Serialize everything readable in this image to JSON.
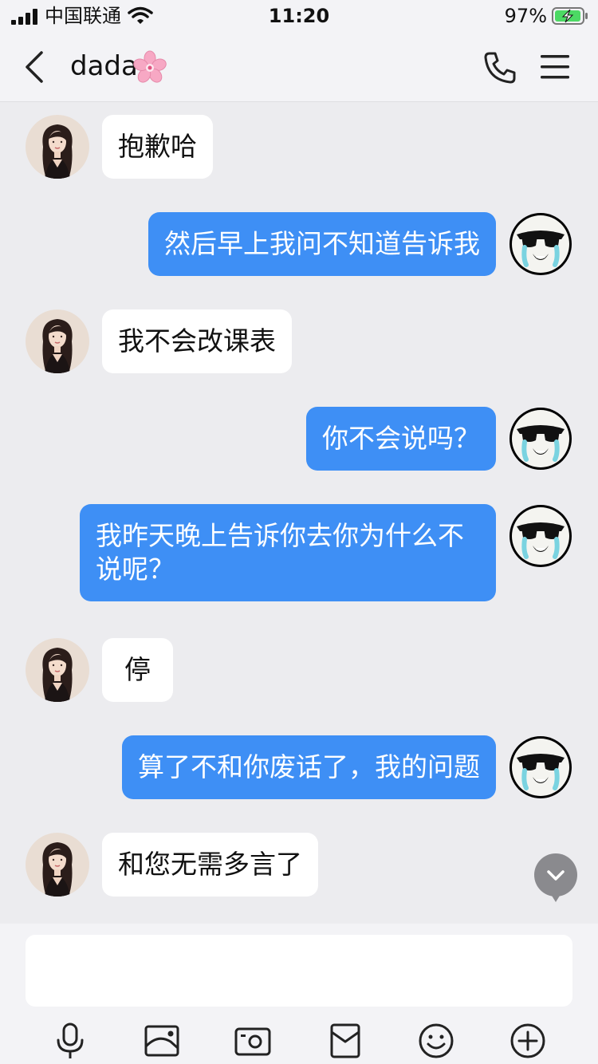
{
  "status_bar": {
    "carrier": "中国联通",
    "time": "11:20",
    "battery_percent": "97%",
    "battery_level": 0.97,
    "icons": [
      "signal-icon",
      "wifi-icon",
      "battery-charging-icon"
    ]
  },
  "nav": {
    "title": "dada",
    "icons": [
      "back-arrow-icon",
      "cherry-blossom-emoji",
      "phone-call-icon",
      "menu-icon"
    ]
  },
  "messages": [
    {
      "side": "left",
      "sender": "dada",
      "text": "抱歉哈"
    },
    {
      "side": "right",
      "sender": "me",
      "text": "然后早上我问不知道告诉我"
    },
    {
      "side": "left",
      "sender": "dada",
      "text": "我不会改课表"
    },
    {
      "side": "right",
      "sender": "me",
      "text": "你不会说吗？"
    },
    {
      "side": "right",
      "sender": "me",
      "text": "我昨天晚上告诉你去你为什么不说呢？"
    },
    {
      "side": "left",
      "sender": "dada",
      "text": "停"
    },
    {
      "side": "right",
      "sender": "me",
      "text": "算了不和你废话了，我的问题"
    },
    {
      "side": "left",
      "sender": "dada",
      "text": "和您无需多言了"
    }
  ],
  "input": {
    "value": "",
    "placeholder": ""
  },
  "toolbar": [
    "microphone-icon",
    "image-icon",
    "camera-icon",
    "red-packet-icon",
    "emoji-icon",
    "plus-icon"
  ],
  "colors": {
    "outgoing_bubble": "#3e8ff5",
    "incoming_bubble": "#ffffff",
    "chat_background": "#ececef",
    "bar_background": "#f3f3f6"
  }
}
